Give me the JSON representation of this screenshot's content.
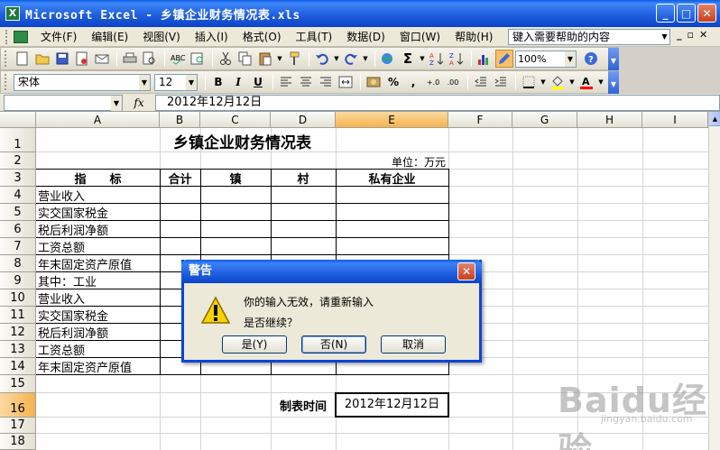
{
  "window": {
    "title": "Microsoft Excel - 乡镇企业财务情况表.xls",
    "app_icon": "X",
    "buttons": [
      "_",
      "□",
      "✕"
    ]
  },
  "menubar": {
    "items": [
      "文件(F)",
      "编辑(E)",
      "视图(V)",
      "插入(I)",
      "格式(O)",
      "工具(T)",
      "数据(D)",
      "窗口(W)",
      "帮助(H)"
    ],
    "help_box": "键入需要帮助的内容",
    "mdi_buttons": [
      "_",
      "▫",
      "✕"
    ]
  },
  "toolbar_standard": {
    "zoom": "100%"
  },
  "toolbar_format": {
    "font": "宋体",
    "size": "12",
    "bold": "B",
    "italic": "I",
    "underline": "U",
    "percent": "%",
    "comma": ","
  },
  "formula_bar": {
    "name_box": "",
    "fx": "fx",
    "content": "2012年12月12日"
  },
  "columns": [
    "A",
    "B",
    "C",
    "D",
    "E",
    "F",
    "G",
    "H",
    "I"
  ],
  "rows": [
    "1",
    "2",
    "3",
    "4",
    "5",
    "6",
    "7",
    "8",
    "9",
    "10",
    "11",
    "12",
    "13",
    "14",
    "15",
    "16",
    "17",
    "18"
  ],
  "sheet": {
    "title": "乡镇企业财务情况表",
    "unit": "单位：万元",
    "headers": {
      "indicator": "指　　标",
      "total": "合计",
      "town": "镇",
      "village": "村",
      "private": "私有企业"
    },
    "indicators": [
      "营业收入",
      "实交国家税金",
      "税后利润净额",
      "工资总额",
      "年末固定资产原值",
      "其中：工业",
      "营业收入",
      "实交国家税金",
      "税后利润净额",
      "工资总额",
      "年末固定资产原值"
    ],
    "made_time_label": "制表时间",
    "made_time_value": "2012年12月12日"
  },
  "dialog": {
    "title": "警告",
    "message": "你的输入无效，请重新输入",
    "question": "是否继续？",
    "yes": "是(Y)",
    "no": "否(N)",
    "cancel": "取消"
  },
  "watermark": {
    "text": "Baidu经验",
    "sub": "jingyan.baidu.com"
  }
}
